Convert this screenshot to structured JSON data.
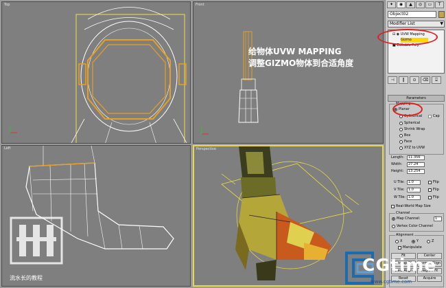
{
  "viewports": {
    "top": {
      "label": "Top"
    },
    "front": {
      "label": "Front"
    },
    "left": {
      "label": "Left"
    },
    "persp": {
      "label": "Perspective"
    }
  },
  "annotation": {
    "line1": "给物体UVW MAPPING",
    "line2": "调整GIZMO物体到合适角度"
  },
  "panel": {
    "tabs": [
      "✦",
      "◉",
      "▲",
      "◎",
      "▭",
      "T"
    ],
    "object_name": "Object02",
    "object_color": "#c9a24a",
    "modifier_list": "Modifier List",
    "stack": {
      "uvw_mapping": "UVW Mapping",
      "gizmo": "Gizmo",
      "editable_poly": "Editable Poly"
    },
    "toolbar": [
      "⊣",
      "‖",
      "⊙",
      "⌫",
      "⌹"
    ],
    "rollout_title": "Parameters",
    "mapping": {
      "title": "Mapping",
      "options": [
        "Planar",
        "Cylindrical",
        "Spherical",
        "Shrink Wrap",
        "Box",
        "Face",
        "XYZ to UVW"
      ],
      "cap": "Cap",
      "selected": "Planar"
    },
    "dims": {
      "length_label": "Length:",
      "length_value": "11.356",
      "width_label": "Width:",
      "width_value": "27.24",
      "height_label": "Height:",
      "height_value": "13.254"
    },
    "tiles": {
      "u_label": "U Tile:",
      "u_value": "1.0",
      "v_label": "V Tile:",
      "v_value": "1.0",
      "w_label": "W Tile:",
      "w_value": "1.0",
      "flip": "Flip"
    },
    "real_world": "Real-World Map Size",
    "channel": {
      "title": "Channel",
      "map_channel": "Map Channel:",
      "map_channel_value": "1",
      "vertex_color": "Vertex Color Channel"
    },
    "alignment": {
      "title": "Alignment",
      "x": "X",
      "y": "Y",
      "z": "Z",
      "manipulate": "Manipulate",
      "fit": "Fit",
      "center": "Center",
      "bitmap_fit": "Bitmap Fit",
      "normal_align": "Normal Align",
      "view_align": "View Align",
      "region_fit": "Region Fit",
      "reset": "Reset",
      "acquire": "Acquire"
    }
  },
  "watermark": {
    "text": "流水长的教程"
  },
  "brand": {
    "logo": "CGtime",
    "url": "www.cgtime.com"
  }
}
